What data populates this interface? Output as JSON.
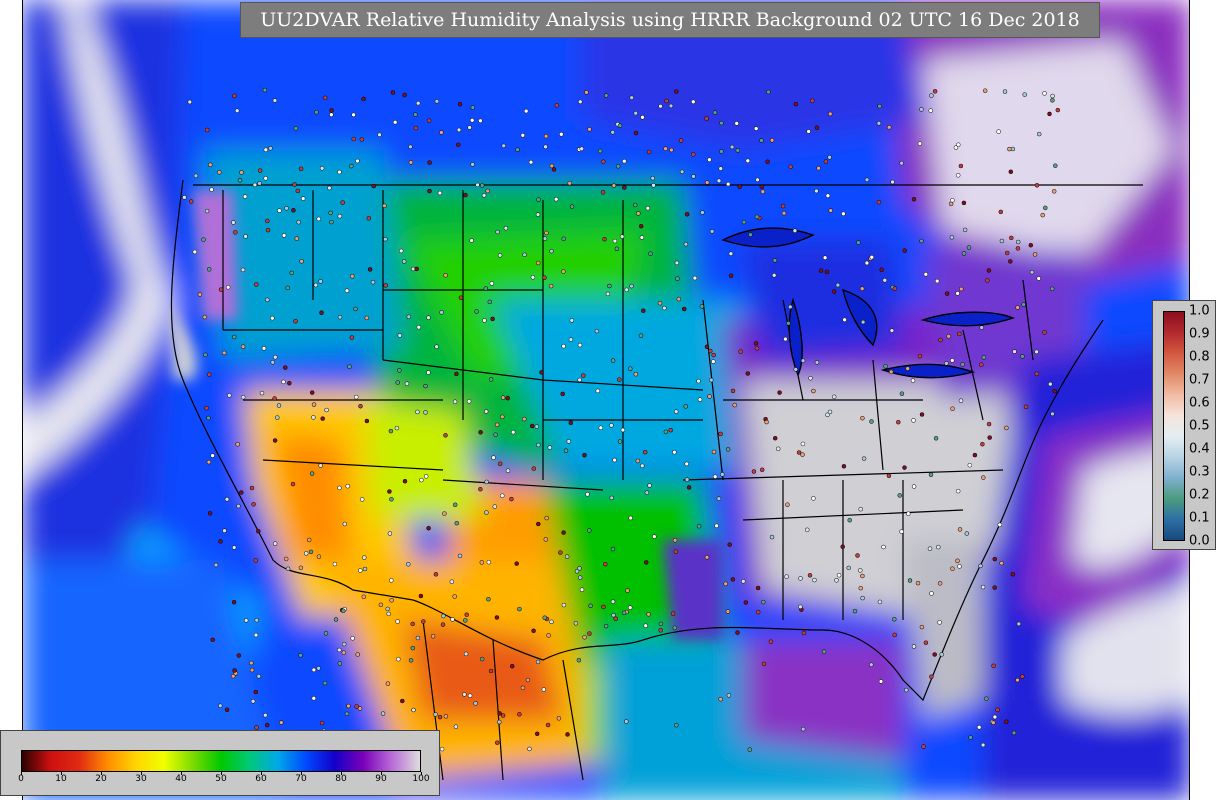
{
  "title": "UU2DVAR Relative Humidity Analysis using HRRR Background 02 UTC 16 Dec 2018",
  "humidity_colorbar": {
    "ticks": [
      "0",
      "10",
      "20",
      "30",
      "40",
      "50",
      "60",
      "70",
      "80",
      "90",
      "100"
    ],
    "colors": [
      "#2b0000",
      "#cc1010",
      "#e02a12",
      "#ff8c00",
      "#ffd400",
      "#f0ff00",
      "#7ddc00",
      "#00c800",
      "#00c878",
      "#00a8e8",
      "#0048ff",
      "#1400c8",
      "#7a00b8",
      "#b86ad8",
      "#dddddd"
    ]
  },
  "obs_colorbar": {
    "ticks": [
      "1.0",
      "0.9",
      "0.8",
      "0.7",
      "0.6",
      "0.5",
      "0.4",
      "0.3",
      "0.2",
      "0.1",
      "0.0"
    ],
    "colors": [
      "#8b0d1f",
      "#b32a2f",
      "#d2593f",
      "#e18a68",
      "#f2bca4",
      "#f4e4dc",
      "#e4eef2",
      "#b7d3e3",
      "#7fb0cf",
      "#4d9b7e",
      "#2e6fa5",
      "#174a7c"
    ]
  }
}
